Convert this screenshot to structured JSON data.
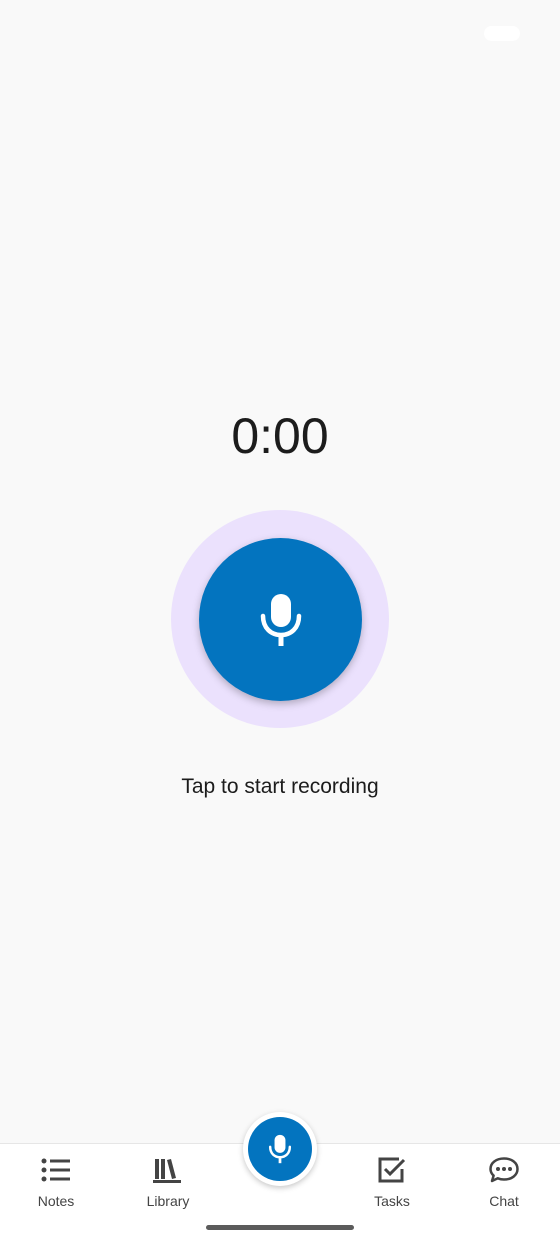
{
  "recorder": {
    "timer": "0:00",
    "hint": "Tap to start recording"
  },
  "nav": {
    "items": [
      {
        "label": "Notes",
        "icon": "list-icon"
      },
      {
        "label": "Library",
        "icon": "books-icon"
      },
      {
        "label": "Tasks",
        "icon": "checkbox-icon"
      },
      {
        "label": "Chat",
        "icon": "chat-bubble-icon"
      }
    ],
    "fab_icon": "microphone-icon"
  },
  "colors": {
    "accent": "#0374bf",
    "halo": "#ebe1fd",
    "background": "#f9f9f9"
  }
}
